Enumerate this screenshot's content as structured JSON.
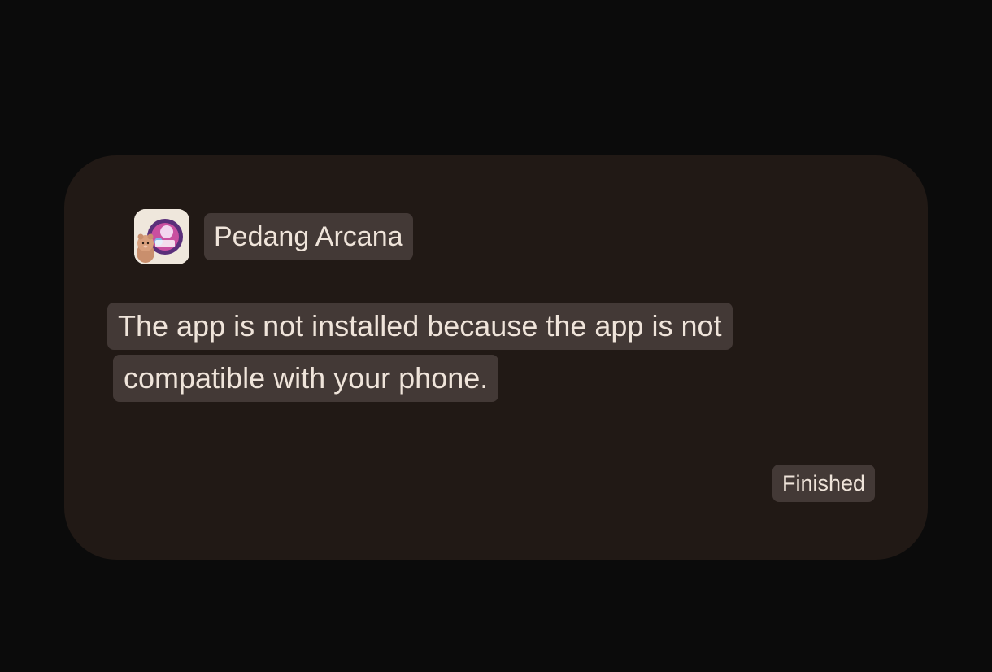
{
  "dialog": {
    "app_name": "Pedang Arcana",
    "message_line1": "The app is not installed because the app is not",
    "message_line2": "compatible with your phone.",
    "finished_label": "Finished"
  },
  "icons": {
    "app_icon": "app-logo-icon"
  },
  "colors": {
    "screen_bg": "#0b0b0b",
    "dialog_bg": "#211915",
    "chip_bg": "#433936",
    "text": "#efe4da"
  }
}
